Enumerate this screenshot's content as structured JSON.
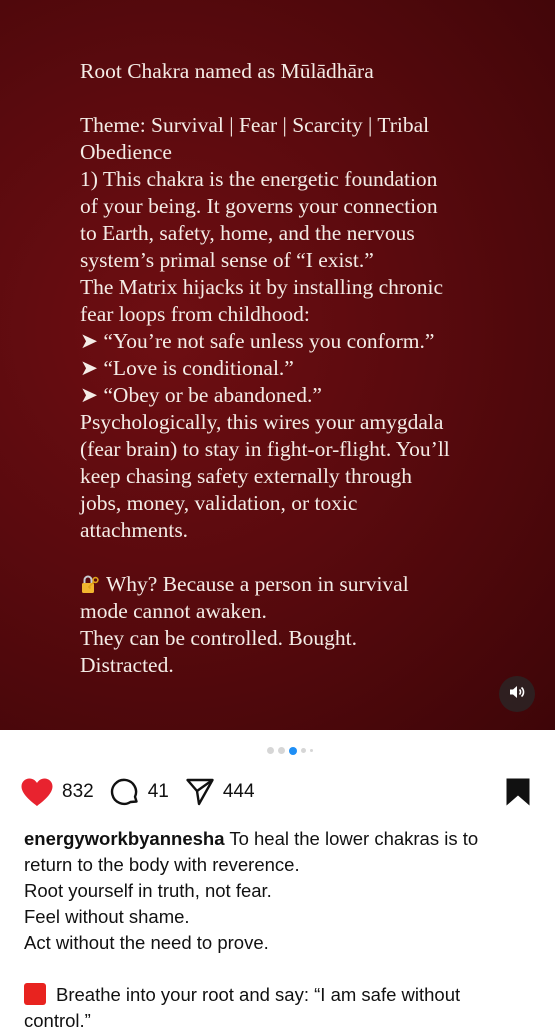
{
  "post_image": {
    "lines": [
      "Root Chakra  named as Mūlādhāra",
      "",
      "Theme: Survival | Fear | Scarcity | Tribal",
      "Obedience",
      "1) This chakra is the energetic foundation",
      "of your being. It governs your connection",
      "to Earth, safety, home, and the nervous",
      "system’s primal sense of “I exist.”",
      "The Matrix hijacks it by installing chronic",
      "fear loops from childhood:",
      "➤ “You’re not safe unless you conform.”",
      "➤ “Love is conditional.”",
      "➤ “Obey or be abandoned.”",
      "Psychologically, this wires your amygdala",
      "(fear brain) to stay in fight-or-flight. You’ll",
      "keep chasing safety externally through",
      "jobs, money, validation, or toxic",
      "attachments.",
      "",
      "Why? Because a person in survival",
      "mode cannot awaken.",
      "They can be controlled. Bought.",
      "Distracted."
    ],
    "lock_icon": "locked-with-key-icon",
    "mute_icon": "speaker-icon"
  },
  "carousel": {
    "total": 5,
    "active_index": 2
  },
  "actions": {
    "likes": "832",
    "comments": "41",
    "shares": "444"
  },
  "caption": {
    "username": "energyworkbyannesha",
    "lines": [
      "To heal the lower chakras is to",
      "return to the body with reverence.",
      "Root yourself in truth, not fear.",
      "Feel without shame.",
      "Act without the need to prove.",
      "",
      "Breathe into your root and say: “I am safe without",
      "control.”"
    ]
  },
  "colors": {
    "background_dark_red": "#5a0a0e",
    "heart_red": "#e8232f",
    "dot_active": "#1e8ef5"
  }
}
